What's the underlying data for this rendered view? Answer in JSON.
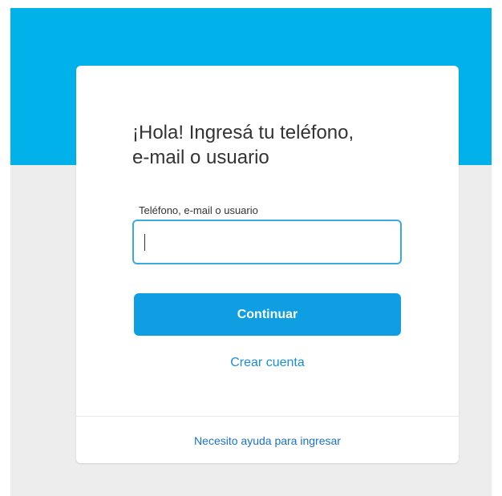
{
  "login": {
    "title_line1": "¡Hola! Ingresá tu teléfono,",
    "title_line2": "e-mail o usuario",
    "field_label": "Teléfono, e-mail o usuario",
    "field_value": "",
    "continue_label": "Continuar",
    "create_account_label": "Crear cuenta",
    "help_label": "Necesito ayuda para ingresar"
  },
  "colors": {
    "header_band": "#00b1ea",
    "page_background": "#ededed",
    "primary_button": "#0f9ee1",
    "link": "#1a8fd6",
    "input_focus_border": "#3aa9e0"
  }
}
